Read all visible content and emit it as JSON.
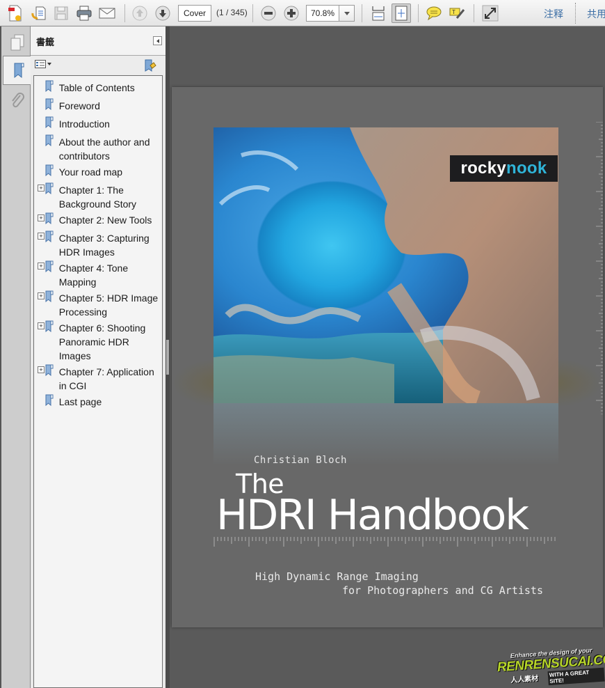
{
  "toolbar": {
    "create_icon": "create-pdf-icon",
    "combine_icon": "combine-files-icon",
    "save_icon": "save-icon",
    "print_icon": "print-icon",
    "email_icon": "email-icon",
    "prev_page_icon": "arrow-up-icon",
    "next_page_icon": "arrow-down-icon",
    "page_field_value": "Cover",
    "page_count": "(1 / 345)",
    "zoom_out_icon": "minus-circle-icon",
    "zoom_in_icon": "plus-circle-icon",
    "zoom_value": "70.8%",
    "fit_width_icon": "fit-width-icon",
    "fit_page_icon": "fit-page-icon",
    "comment_icon": "speech-bubble-icon",
    "highlight_icon": "highlight-text-icon",
    "fullscreen_icon": "expand-icon",
    "comment_label": "注释",
    "share_label": "共用"
  },
  "rail": {
    "pages_icon": "pages-icon",
    "bookmarks_icon": "bookmark-icon",
    "attachments_icon": "paperclip-icon"
  },
  "bookmarks_panel": {
    "title": "書籤",
    "options_icon": "options-list-icon",
    "new_bookmark_icon": "new-bookmark-icon",
    "items": [
      {
        "label": "Table of Contents",
        "expandable": false
      },
      {
        "label": "Foreword",
        "expandable": false
      },
      {
        "label": "Introduction",
        "expandable": false
      },
      {
        "label": "About the author and contributors",
        "expandable": false
      },
      {
        "label": "Your road map",
        "expandable": false
      },
      {
        "label": "Chapter 1: The Background Story",
        "expandable": true
      },
      {
        "label": "Chapter 2: New Tools",
        "expandable": true
      },
      {
        "label": "Chapter 3: Capturing HDR Images",
        "expandable": true
      },
      {
        "label": "Chapter 4: Tone Mapping",
        "expandable": true
      },
      {
        "label": "Chapter 5: HDR Image Processing",
        "expandable": true
      },
      {
        "label": "Chapter 6: Shooting Panoramic HDR Images",
        "expandable": true
      },
      {
        "label": "Chapter 7: Application in CGI",
        "expandable": true
      },
      {
        "label": "Last page",
        "expandable": false
      }
    ],
    "expand_glyph": "+"
  },
  "cover": {
    "publisher_a": "rocky",
    "publisher_b": "nook",
    "author": "Christian Bloch",
    "title_the": "The",
    "title_main": "HDRI Handbook",
    "subtitle_line1": "High Dynamic Range Imaging",
    "subtitle_line2": "for Photographers and CG Artists"
  },
  "watermark": {
    "tagline": "Enhance the design of your",
    "site": "RENRENSUCAI.COM",
    "chinese": "人人素材",
    "slogan": "WITH A GREAT SITE!"
  },
  "colors": {
    "accent_link": "#3b6ea5",
    "publisher_accent": "#2fb4d8",
    "watermark_green": "#b7d52a"
  }
}
